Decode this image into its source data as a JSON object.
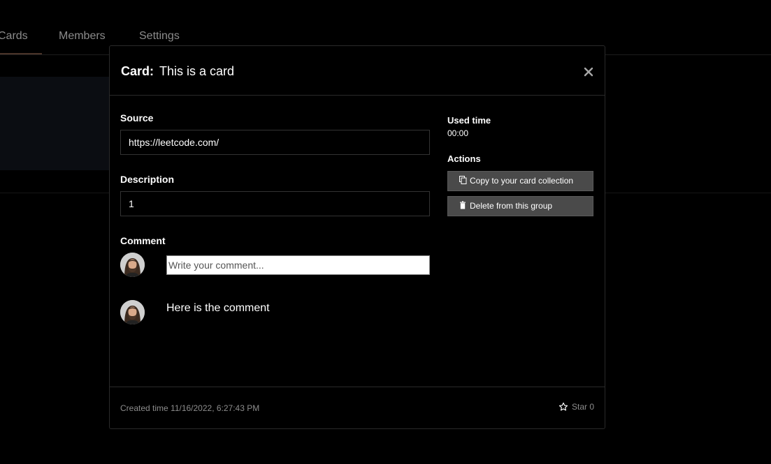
{
  "background": {
    "tabs": [
      {
        "label": "Cards",
        "active": true
      },
      {
        "label": "Members",
        "active": false
      },
      {
        "label": "Settings",
        "active": false
      }
    ]
  },
  "modal": {
    "title_label": "Card:",
    "title_value": "This is a card",
    "close_icon": "close-icon",
    "source_label": "Source",
    "source_value": "https://leetcode.com/",
    "description_label": "Description",
    "description_value": "1",
    "comment_label": "Comment",
    "comment_placeholder": "Write your comment...",
    "comments": [
      {
        "text": "Here is the comment"
      }
    ],
    "used_time_label": "Used time",
    "used_time_value": "00:00",
    "actions_label": "Actions",
    "actions": [
      {
        "label": "Copy to your card collection",
        "icon": "copy-icon"
      },
      {
        "label": "Delete from this group",
        "icon": "trash-icon"
      }
    ],
    "created_time": "Created time 11/16/2022, 6:27:43 PM",
    "star_label": "Star 0"
  },
  "colors": {
    "background": "#000000",
    "button": "#4a4a4a",
    "muted_text": "#8c8c8c"
  }
}
